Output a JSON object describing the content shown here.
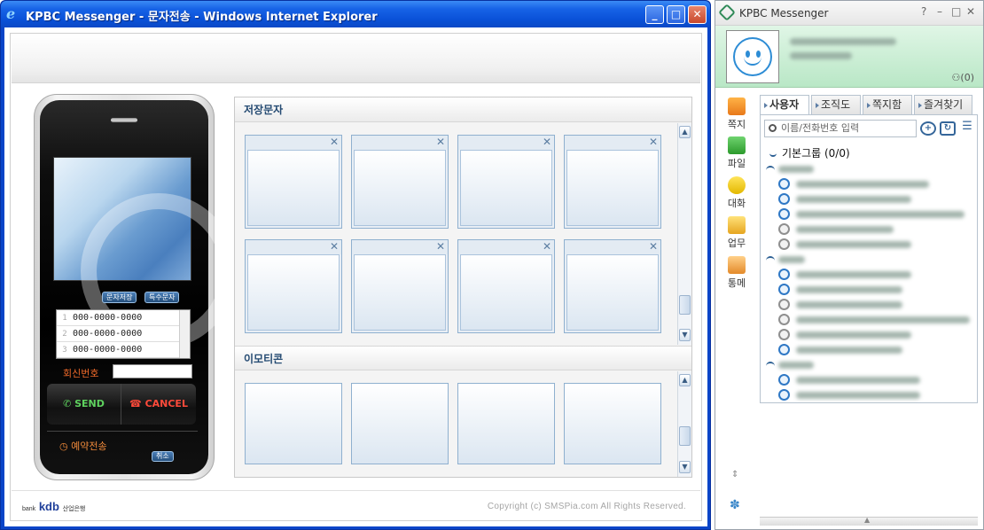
{
  "ie": {
    "title": "KPBC Messenger - 문자전송 - Windows Internet Explorer",
    "btn_minimize": "_",
    "btn_maximize": "□",
    "btn_close": "✕"
  },
  "phone": {
    "save_msg": "문자저장",
    "special_char": "특수문자",
    "numbers": [
      {
        "idx": "1",
        "value": "000-0000-0000"
      },
      {
        "idx": "2",
        "value": "000-0000-0000"
      },
      {
        "idx": "3",
        "value": "000-0000-0000"
      }
    ],
    "callback_label": "회신번호",
    "send": "SEND",
    "cancel": "CANCEL",
    "reserve_label": "예약전송",
    "reserve_cancel": "취소"
  },
  "panel": {
    "saved_title": "저장문자",
    "emoticon_title": "이모티콘",
    "card_close": "✕"
  },
  "footer": {
    "brand": "kdb",
    "brand_small_pre": "bank",
    "brand_small": "산업은행",
    "copyright": "Copyright (c) SMSPia.com All Rights Reserved."
  },
  "messenger": {
    "title": "KPBC Messenger",
    "help": "?",
    "min": "–",
    "max": "□",
    "close": "✕",
    "count": "(0)",
    "sidebar": [
      "쪽지",
      "파일",
      "대화",
      "업무",
      "통메"
    ],
    "tabs": [
      "사용자",
      "조직도",
      "쪽지함",
      "즐겨찾기"
    ],
    "search_placeholder": "이름/전화번호 입력",
    "root_group": "기본그룹 (0/0)"
  },
  "colors": {
    "ie_title": "#0b51d8",
    "messenger_profile": "#bfe9cb",
    "accent_orange": "#f06a2a"
  }
}
